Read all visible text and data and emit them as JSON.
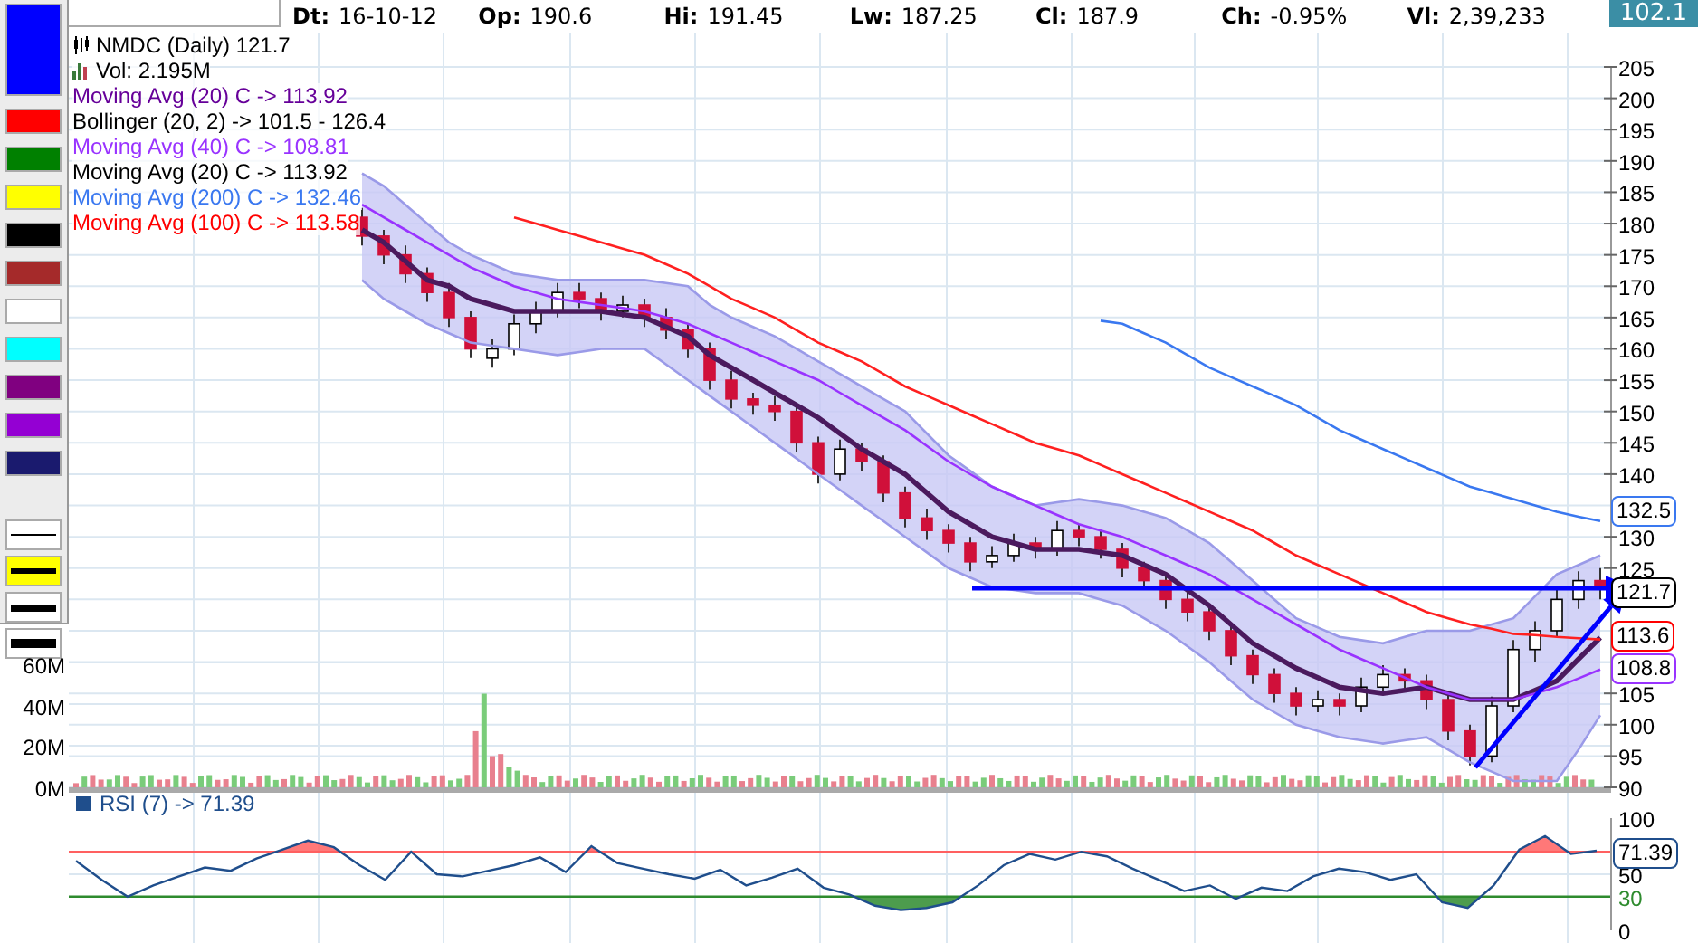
{
  "palette": {
    "colors": [
      {
        "color": "#0000ff",
        "selected": true
      },
      {
        "color": "#ff0000",
        "selected": false
      },
      {
        "color": "#008000",
        "selected": false
      },
      {
        "color": "#ffff00",
        "selected": false
      },
      {
        "color": "#000000",
        "selected": false
      },
      {
        "color": "#a52a2a",
        "selected": false
      },
      {
        "color": "#ffffff",
        "selected": false
      },
      {
        "color": "#00ffff",
        "selected": false
      },
      {
        "color": "#800080",
        "selected": false
      },
      {
        "color": "#9400d3",
        "selected": false
      },
      {
        "color": "#1a1a6e",
        "selected": false
      }
    ],
    "line_styles": [
      {
        "kind": "thin",
        "selected": false
      },
      {
        "kind": "medium",
        "selected": true
      },
      {
        "kind": "thick",
        "selected": false
      },
      {
        "kind": "heavy",
        "selected": false
      }
    ]
  },
  "quote": [
    {
      "label": "Dt:",
      "value": "16-10-12"
    },
    {
      "label": "Op:",
      "value": "190.6"
    },
    {
      "label": "Hi:",
      "value": "191.45"
    },
    {
      "label": "Lw:",
      "value": "187.25"
    },
    {
      "label": "Cl:",
      "value": "187.9"
    },
    {
      "label": "Ch:",
      "value": "-0.95%"
    },
    {
      "label": "Vl:",
      "value": "2,39,233"
    }
  ],
  "last_price": "102.1",
  "legend": [
    {
      "kind": "price",
      "text": "NMDC (Daily) 121.7",
      "color": "#000000"
    },
    {
      "kind": "volume",
      "text": "Vol: 2.195M",
      "color": "#000000"
    },
    {
      "kind": "indicator",
      "reading": "-> 113.92",
      "color": "#660099"
    },
    {
      "kind": "indicator",
      "reading": "-> 101.5 - 126.4",
      "color": "#000000"
    },
    {
      "kind": "indicator",
      "reading": "-> 108.81",
      "color": "#9933ff"
    },
    {
      "kind": "indicator",
      "text": "Moving Avg (20) C -> 113.92",
      "color": "#000000"
    },
    {
      "kind": "indicator",
      "reading": "-> 132.46",
      "color": "#3a78f0"
    },
    {
      "kind": "indicator",
      "reading": "-> 113.58",
      "color": "#ff0000"
    }
  ],
  "price_chart": {
    "chart_data": {
      "type": "candlestick",
      "ylim": [
        90,
        205
      ],
      "yticks": [
        205,
        200,
        195,
        190,
        185,
        180,
        175,
        170,
        165,
        160,
        155,
        150,
        145,
        140,
        130,
        125,
        105,
        100,
        95,
        90
      ],
      "grid": true,
      "ohlc": [
        null,
        null,
        [
          181,
          182.5,
          176.5,
          178
        ],
        [
          178,
          179,
          173.5,
          175
        ],
        [
          175,
          176.5,
          170.5,
          172
        ],
        [
          172,
          173,
          167.5,
          169
        ],
        [
          169,
          170.5,
          163.5,
          165
        ],
        [
          165,
          166,
          158.5,
          160
        ],
        [
          158.5,
          161.5,
          157,
          160
        ],
        [
          160,
          165.5,
          159,
          164
        ],
        [
          164,
          167.5,
          162.5,
          166
        ],
        [
          166,
          170.5,
          165,
          169
        ],
        [
          169,
          170.5,
          166.5,
          168
        ],
        [
          168,
          169,
          164.5,
          166
        ],
        [
          166,
          168.5,
          165,
          167
        ],
        [
          167,
          168,
          163.5,
          165
        ],
        [
          165,
          166.5,
          161.5,
          163
        ],
        [
          163,
          164,
          158.5,
          160
        ],
        [
          160,
          161,
          153.5,
          155
        ],
        [
          155,
          156.5,
          150.5,
          152
        ],
        [
          152,
          153,
          149.5,
          151
        ],
        [
          151,
          152.5,
          148.5,
          150
        ],
        [
          150,
          151,
          143.5,
          145
        ],
        [
          145,
          146,
          138.5,
          140
        ],
        [
          140,
          145.5,
          139,
          144
        ],
        [
          144,
          145,
          140.5,
          142
        ],
        [
          142,
          143,
          135.5,
          137
        ],
        [
          137,
          138,
          131.5,
          133
        ],
        [
          133,
          134.5,
          129.5,
          131
        ],
        [
          131,
          132,
          127.5,
          129
        ],
        [
          129,
          130,
          124.5,
          126
        ],
        [
          126,
          128.5,
          125,
          127
        ],
        [
          127,
          130.5,
          126,
          129
        ],
        [
          129,
          130,
          126.5,
          128
        ],
        [
          128,
          132.5,
          127,
          131
        ],
        [
          131,
          132,
          128.5,
          130
        ],
        [
          130,
          131,
          126.5,
          128
        ],
        [
          128,
          129,
          123.5,
          125
        ],
        [
          125,
          126,
          121.5,
          123
        ],
        [
          123,
          124,
          118.5,
          120
        ],
        [
          120,
          121.5,
          116.5,
          118
        ],
        [
          118,
          119,
          113.5,
          115
        ],
        [
          115,
          116,
          109.5,
          111
        ],
        [
          111,
          112,
          106.5,
          108
        ],
        [
          108,
          109,
          103.5,
          105
        ],
        [
          105,
          106,
          101.5,
          103
        ],
        [
          103,
          105.5,
          102,
          104
        ],
        [
          104,
          105,
          101.5,
          103
        ],
        [
          103,
          107.5,
          102,
          106
        ],
        [
          106,
          109.5,
          105,
          108
        ],
        [
          108,
          109,
          105.5,
          107
        ],
        [
          107,
          108,
          102.5,
          104
        ],
        [
          104,
          105,
          97.5,
          99
        ],
        [
          99,
          100,
          93.5,
          95
        ],
        [
          95,
          104.5,
          94,
          103
        ],
        [
          103,
          113.5,
          102,
          112
        ],
        [
          112,
          116.5,
          110,
          115
        ],
        [
          115,
          121.5,
          114,
          120
        ],
        [
          120,
          124.5,
          118.5,
          123
        ],
        [
          123,
          125,
          120,
          121.7
        ]
      ]
    }
  },
  "indicators": {
    "chart_data": {
      "type": "line",
      "ylim": [
        90,
        205
      ],
      "series": [
        {
          "name": "Moving Avg (20) C",
          "color": "#4b1a5e",
          "values": [
            null,
            null,
            179,
            177,
            174,
            171,
            170,
            168,
            167,
            166,
            166,
            166,
            166,
            166,
            165.5,
            165,
            163.5,
            162,
            159,
            157,
            155,
            153,
            151,
            149,
            146.5,
            144,
            142,
            140,
            137,
            134,
            132,
            130,
            129,
            128,
            128,
            128,
            127.5,
            127,
            125.5,
            124,
            121.5,
            119,
            116,
            113,
            111,
            109,
            107.5,
            106,
            105.5,
            105,
            105.5,
            106,
            105,
            104,
            104,
            104,
            105.5,
            107,
            110.5,
            113.9
          ]
        },
        {
          "name": "Bollinger (20, 2)",
          "color": "#9a9ae8",
          "values": [
            null,
            null,
            188,
            186,
            183,
            180,
            177,
            175,
            173.5,
            172,
            171.5,
            171,
            171,
            171,
            171,
            171,
            170.5,
            170,
            167,
            165,
            163.5,
            162,
            160,
            158,
            156,
            154,
            152,
            150,
            146.5,
            143,
            140.5,
            138,
            136.5,
            135,
            135.5,
            136,
            135.5,
            135,
            134,
            133,
            131,
            129,
            126,
            123,
            120,
            117,
            115.5,
            114,
            113.5,
            113,
            114,
            115,
            115,
            115,
            116,
            117,
            120.5,
            124,
            125.5,
            127
          ]
        },
        {
          "name": "Moving Avg (40) C",
          "color": "#9933ff",
          "values": [
            null,
            null,
            183,
            181,
            179,
            177,
            175,
            173,
            171.5,
            170,
            169,
            168,
            167.5,
            167,
            166.5,
            166,
            165,
            164,
            162.5,
            161,
            159.5,
            158,
            156.5,
            155,
            153,
            151,
            149,
            147,
            144.5,
            142,
            140,
            138,
            136.5,
            135,
            133.5,
            132,
            131,
            130,
            128.5,
            127,
            125.5,
            124,
            122,
            120,
            118,
            116,
            114,
            112,
            110.5,
            109,
            107.5,
            106,
            105,
            104,
            104,
            104,
            105,
            106,
            107.4,
            108.8
          ]
        },
        {
          "name": "Moving Avg (200) C",
          "color": "#3a78f0",
          "values": [
            null,
            null,
            null,
            null,
            null,
            null,
            null,
            null,
            null,
            null,
            null,
            null,
            null,
            null,
            null,
            null,
            null,
            null,
            null,
            null,
            null,
            null,
            null,
            null,
            null,
            null,
            null,
            null,
            null,
            null,
            null,
            null,
            null,
            null,
            null,
            null,
            164.5,
            164,
            162.5,
            161,
            159,
            157,
            155.5,
            154,
            152.5,
            151,
            149,
            147,
            145.5,
            144,
            142.5,
            141,
            139.5,
            138,
            137,
            136,
            135,
            134,
            133.2,
            132.5
          ]
        },
        {
          "name": "Moving Avg (100) C",
          "color": "#ff2020",
          "values": [
            null,
            null,
            null,
            null,
            null,
            null,
            null,
            null,
            null,
            181,
            180,
            179,
            178,
            177,
            176,
            175,
            173.5,
            172,
            170,
            168,
            166.5,
            165,
            163,
            161,
            159.5,
            158,
            156,
            154,
            152.5,
            151,
            149.5,
            148,
            146.5,
            145,
            144,
            143,
            141.5,
            140,
            138.5,
            137,
            135.5,
            134,
            132.5,
            131,
            129,
            127,
            125.5,
            124,
            122.5,
            121,
            119.5,
            118,
            117,
            116,
            115.3,
            114.5,
            114.3,
            114,
            113.8,
            113.6
          ]
        },
        {
          "color": "#9a9ae8",
          "values": [
            null,
            null,
            171,
            168,
            166,
            164,
            162.5,
            161,
            160.5,
            160,
            159.5,
            159,
            159.5,
            160,
            160,
            160,
            157.5,
            155,
            152.5,
            150,
            147.5,
            145,
            142.5,
            140,
            137.5,
            135,
            132.5,
            130,
            127.5,
            125,
            123.5,
            122,
            121.5,
            121,
            121,
            121,
            120,
            119,
            117,
            115,
            112.5,
            110,
            107,
            104,
            102,
            100,
            99,
            98,
            97.5,
            97,
            97.5,
            98,
            96,
            94,
            92.5,
            91,
            91,
            91,
            96,
            101.5
          ]
        }
      ]
    }
  },
  "price_markers": [
    {
      "text": "132.5",
      "color": "#3a78f0"
    },
    {
      "text": "121.7",
      "color": "#000000"
    },
    {
      "text": "113.6",
      "color": "#ff0000"
    },
    {
      "text": "108.8",
      "color": "#9933ff"
    }
  ],
  "volume_axis": [
    "60M",
    "40M",
    "20M",
    "0M"
  ],
  "rsi_chart": {
    "reading": "-> 71.39",
    "marker": "71.39",
    "chart_data": {
      "type": "line",
      "ylim": [
        0,
        100
      ],
      "yticks": [
        100,
        50,
        30,
        0
      ],
      "grid": true,
      "ref_lines": [
        {
          "axis": "y",
          "value": 70,
          "color": "#ff6060"
        },
        {
          "axis": "y",
          "value": 30,
          "color": "#2e8b2e"
        }
      ],
      "series": [
        {
          "name": "RSI (7)",
          "color": "#1f4e8c",
          "values": [
            62,
            45,
            30,
            40,
            48,
            56,
            53,
            64,
            72,
            80,
            74,
            58,
            45,
            70,
            50,
            48,
            53,
            58,
            65,
            52,
            75,
            60,
            55,
            50,
            46,
            54,
            40,
            47,
            55,
            38,
            32,
            22,
            18,
            20,
            25,
            40,
            58,
            68,
            63,
            70,
            66,
            55,
            45,
            35,
            40,
            28,
            38,
            35,
            48,
            55,
            52,
            45,
            50,
            25,
            20,
            40,
            72,
            84,
            68,
            71
          ]
        }
      ]
    }
  }
}
